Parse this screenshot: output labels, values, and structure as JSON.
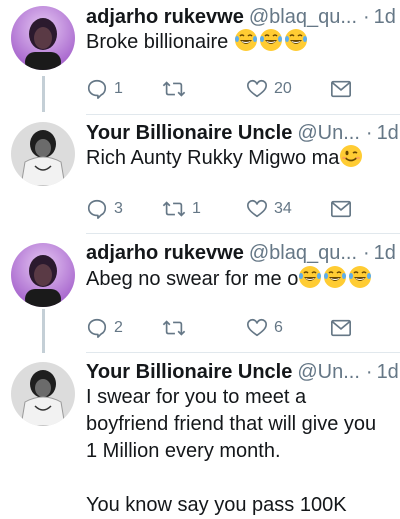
{
  "tweets": [
    {
      "name": "adjarho rukevwe",
      "handle": "@blaq_qu...",
      "sep": "·",
      "time": "1d",
      "text": "Broke billionaire",
      "trailing_emoji": [
        "laughing-tears",
        "laughing-tears",
        "laughing-tears"
      ],
      "reply_count": "1",
      "retweet_count": "",
      "like_count": "20"
    },
    {
      "name": "Your Billionaire Uncle",
      "handle": "@Un...",
      "sep": "·",
      "time": "1d",
      "text": "Rich Aunty Rukky Migwo ma",
      "trailing_emoji": [
        "wink"
      ],
      "reply_count": "3",
      "retweet_count": "1",
      "like_count": "34"
    },
    {
      "name": "adjarho rukevwe",
      "handle": "@blaq_qu...",
      "sep": "·",
      "time": "1d",
      "text": "Abeg no swear for me o",
      "trailing_emoji": [
        "laughing-tears",
        "laughing-tears",
        "laughing-tears"
      ],
      "reply_count": "2",
      "retweet_count": "",
      "like_count": "6"
    },
    {
      "name": "Your Billionaire Uncle",
      "handle": "@Un...",
      "sep": "·",
      "time": "1d",
      "text": "I swear for you to meet a boyfriend friend that will give you 1 Million every month.\n\nYou know say you pass 100K",
      "trailing_emoji": [],
      "reply_count": "",
      "retweet_count": "",
      "like_count": ""
    }
  ],
  "icons": {
    "reply": "reply-icon",
    "retweet": "retweet-icon",
    "like": "heart-icon",
    "dm": "envelope-icon",
    "caret": "chevron-down-icon"
  },
  "colors": {
    "text": "#14171a",
    "muted": "#657786",
    "thread_line": "#c4cfd6",
    "divider": "#e1e8ed",
    "emoji_face": "#ffcc33"
  }
}
